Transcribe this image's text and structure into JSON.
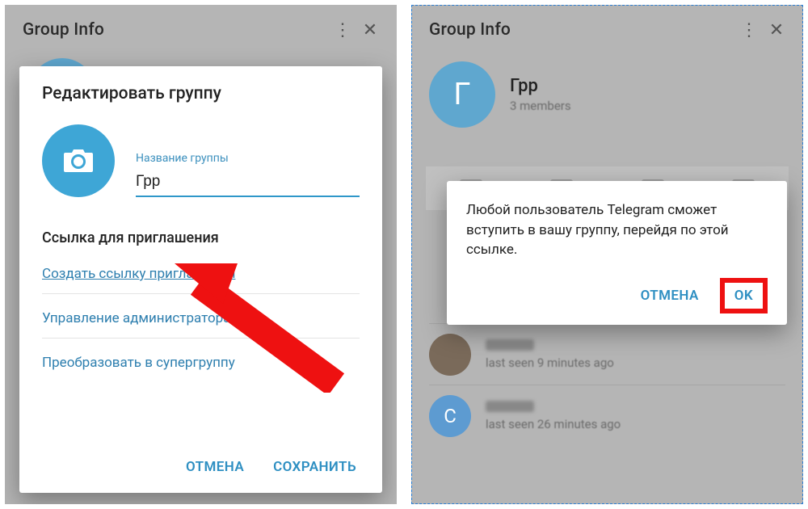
{
  "left": {
    "topbar": {
      "title": "Group Info"
    },
    "dialog": {
      "title": "Редактировать группу",
      "name_label": "Название группы",
      "name_value": "Грр",
      "section": "Ссылка для приглашения",
      "links": {
        "create": "Создать ссылку приглашения",
        "admins": "Управление администраторам",
        "convert": "Преобразовать в супергруппу"
      },
      "actions": {
        "cancel": "ОТМЕНА",
        "save": "СОХРАНИТЬ"
      }
    }
  },
  "right": {
    "topbar": {
      "title": "Group Info"
    },
    "group": {
      "initial": "Г",
      "name": "Грр",
      "subtitle": "3 members"
    },
    "members": [
      {
        "status": "last seen 9 minutes ago"
      },
      {
        "status": "last seen 26 minutes ago",
        "initial": "C"
      }
    ],
    "confirm": {
      "body": "Любой пользователь Telegram сможет вступить в вашу группу, перейдя по этой ссылке.",
      "cancel": "ОТМЕНА",
      "ok": "OK"
    }
  }
}
